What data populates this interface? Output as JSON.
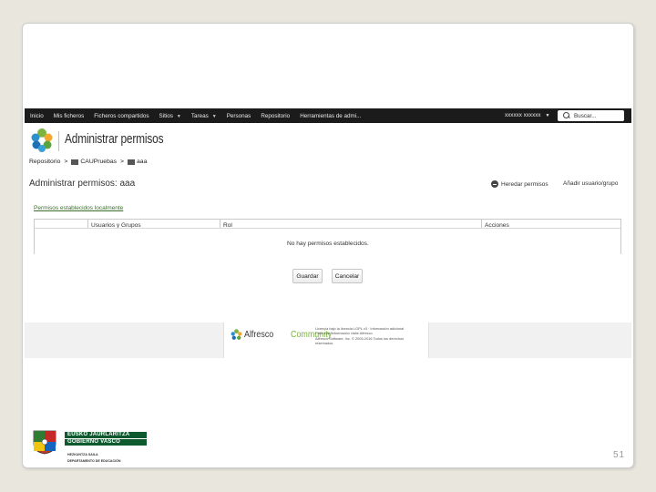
{
  "navbar": {
    "items": [
      {
        "label": "Inicio",
        "dropdown": false
      },
      {
        "label": "Mis ficheros",
        "dropdown": false
      },
      {
        "label": "Ficheros compartidos",
        "dropdown": false
      },
      {
        "label": "Sitios",
        "dropdown": true
      },
      {
        "label": "Tareas",
        "dropdown": true
      },
      {
        "label": "Personas",
        "dropdown": false
      },
      {
        "label": "Repositorio",
        "dropdown": false
      },
      {
        "label": "Herramientas de admi...",
        "dropdown": false
      }
    ],
    "user": "xxxxxx xxxxxx",
    "search_placeholder": "Buscar..."
  },
  "header": {
    "title": "Administrar permisos"
  },
  "breadcrumb": {
    "root": "Repositorio",
    "separator": ">",
    "items": [
      "CAUPruebas",
      "aaa"
    ]
  },
  "main": {
    "subtitle": "Administrar permisos: aaa",
    "inherit_action": "Heredar permisos",
    "add_action": "Añadir usuario/grupo",
    "section_title": "Permisos establecidos localmente",
    "table": {
      "columns": [
        "Usuarios y Grupos",
        "Rol",
        "Acciones"
      ],
      "empty_message": "No hay permisos establecidos."
    },
    "save_label": "Guardar",
    "cancel_label": "Cancelar"
  },
  "footer": {
    "brand_part1": "Alfresco",
    "brand_part2": "Community",
    "legal_lines": [
      "Licencia bajo la licencia LGPL v3 · Información adicional",
      "Para más información visite Alfresco",
      "Alfresco Software, Inc. © 2005-2016 Todos los derechos",
      "reservados."
    ]
  },
  "government": {
    "line1": "EUSKO JAURLARITZA",
    "line2": "GOBIERNO VASCO",
    "dept1": "HEZKUNTZA SAILA",
    "dept2": "DEPARTAMENTO DE EDUCACIÓN"
  },
  "slide_number": "51",
  "colors": {
    "navbar_bg": "#1b1b1b",
    "link_green": "#3c6e2f",
    "alfresco_green": "#7ab33f",
    "gov_green": "#0d5a2e"
  }
}
